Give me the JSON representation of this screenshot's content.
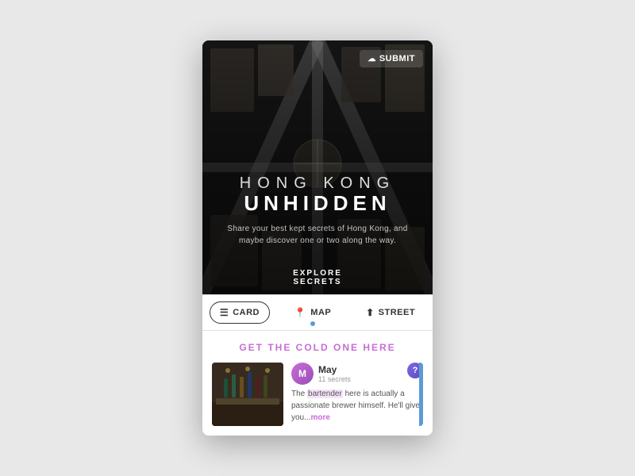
{
  "app": {
    "title": "Hong Kong Unhidden"
  },
  "hero": {
    "submit_label": "SUBMIT",
    "title_line1": "HONG KONG",
    "title_line2": "UNHIDDEN",
    "subtitle": "Share your best kept secrets of Hong Kong, and\nmaybe discover one or two along the way.",
    "explore_label": "EXPLORE SECRETS"
  },
  "tabs": [
    {
      "id": "card",
      "icon": "≡",
      "label": "CARD",
      "active": true
    },
    {
      "id": "map",
      "icon": "📍",
      "label": "MAP",
      "active": false
    },
    {
      "id": "street",
      "icon": "⬆",
      "label": "STREET",
      "active": false
    }
  ],
  "secret_card": {
    "section_title": "GET THE COLD ONE HERE",
    "user": {
      "name": "May",
      "secrets_count": "11 secrets",
      "avatar_initial": "M"
    },
    "text_prefix": "The ",
    "text_highlight": "bartender",
    "text_body": " here is actually a passionate brewer himself. He'll give you...",
    "more_label": "more"
  },
  "icons": {
    "cloud": "☁",
    "card": "☰",
    "map": "📍",
    "street": "⬆",
    "question": "?"
  }
}
